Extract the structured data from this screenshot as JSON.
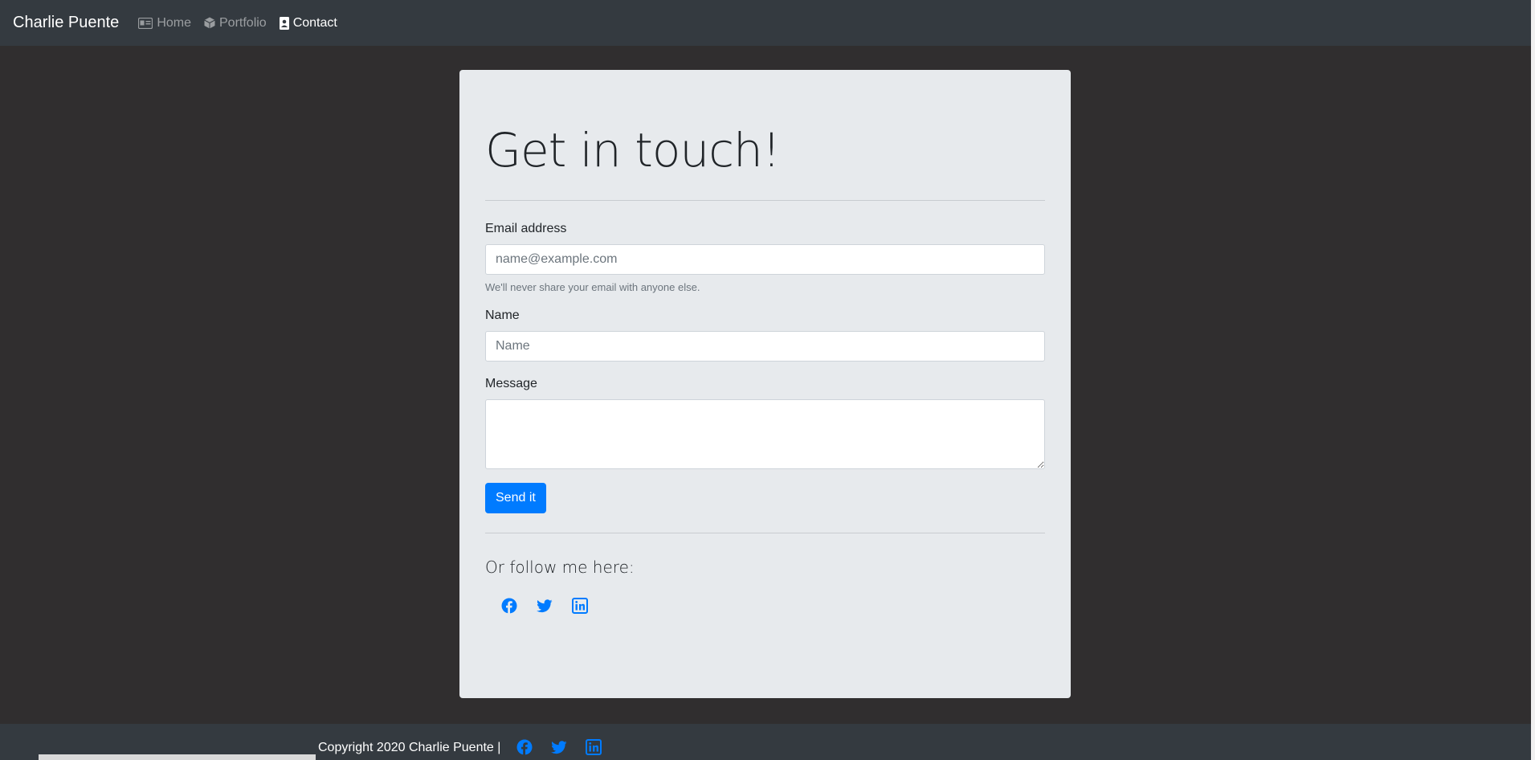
{
  "navbar": {
    "brand": "Charlie Puente",
    "items": [
      {
        "label": "Home",
        "icon": "id-card-icon",
        "active": false
      },
      {
        "label": "Portfolio",
        "icon": "cube-icon",
        "active": false
      },
      {
        "label": "Contact",
        "icon": "contact-icon",
        "active": true
      }
    ]
  },
  "form": {
    "heading": "Get in touch!",
    "email_label": "Email address",
    "email_placeholder": "name@example.com",
    "email_help": "We'll never share your email with anyone else.",
    "name_label": "Name",
    "name_placeholder": "Name",
    "message_label": "Message",
    "message_value": "",
    "submit_label": "Send it",
    "follow_text": "Or follow me here:",
    "socials": [
      "facebook-icon",
      "twitter-icon",
      "linkedin-icon"
    ]
  },
  "footer": {
    "copyright": "Copyright 2020 Charlie Puente |",
    "socials": [
      "facebook-icon",
      "twitter-icon",
      "linkedin-icon"
    ]
  },
  "colors": {
    "page_bg": "#302e2f",
    "navbar_bg": "#343a40",
    "card_bg": "#e7eaed",
    "accent": "#007bff"
  }
}
